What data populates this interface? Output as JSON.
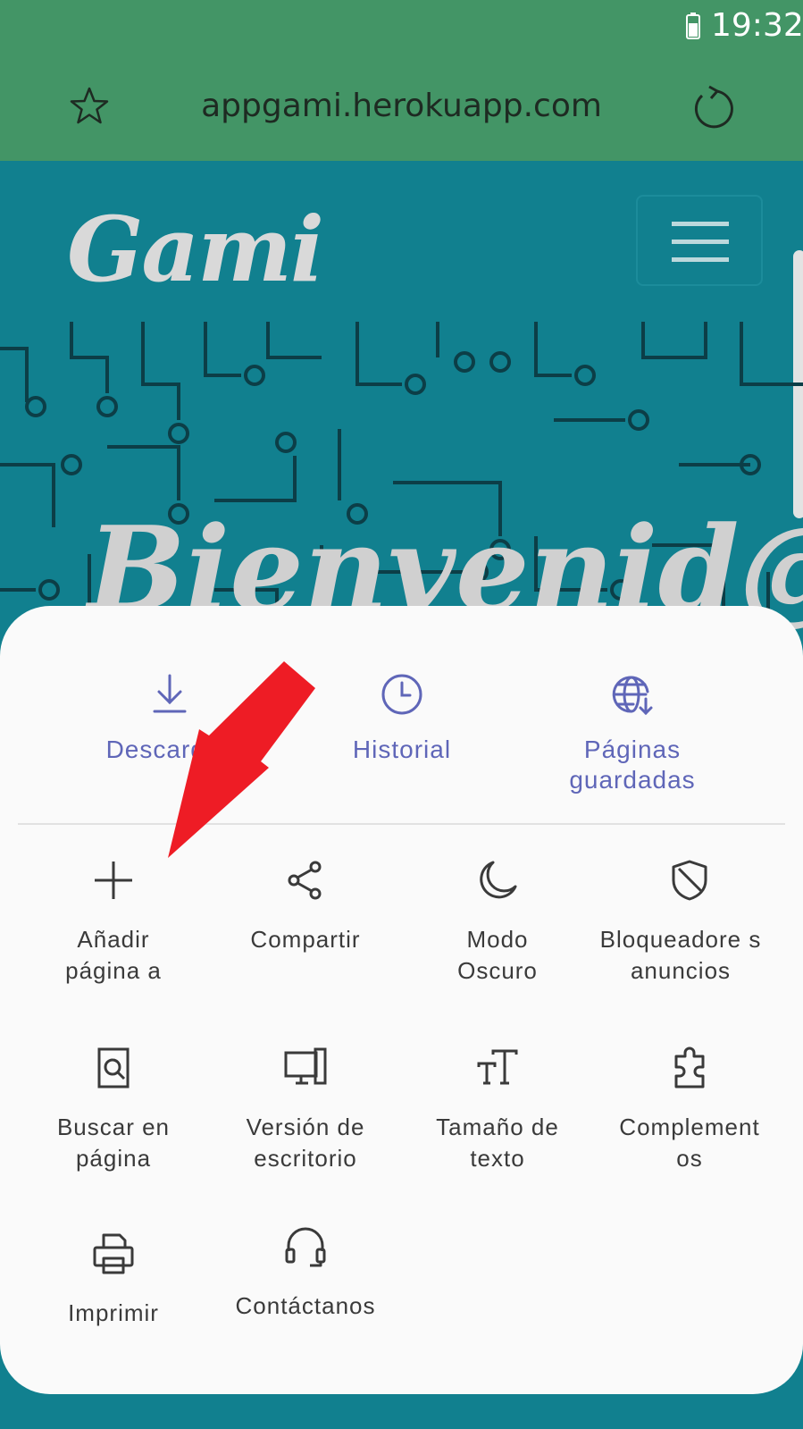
{
  "status_bar": {
    "time": "19:32"
  },
  "browser": {
    "url": "appgami.herokuapp.com"
  },
  "page": {
    "logo": "Gami",
    "welcome": "Bienvenid@s"
  },
  "quick_actions": [
    {
      "label": "Descargas",
      "icon": "download-icon"
    },
    {
      "label": "Historial",
      "icon": "clock-icon"
    },
    {
      "label": "Páginas guardadas",
      "icon": "globe-download-icon"
    }
  ],
  "menu_items": [
    {
      "label": "Añadir página a",
      "icon": "plus-icon"
    },
    {
      "label": "Compartir",
      "icon": "share-icon"
    },
    {
      "label": "Modo Oscuro",
      "icon": "moon-icon"
    },
    {
      "label": "Bloqueadore s anuncios",
      "icon": "shield-icon"
    },
    {
      "label": "Buscar en página",
      "icon": "find-in-page-icon"
    },
    {
      "label": "Versión de escritorio",
      "icon": "desktop-icon"
    },
    {
      "label": "Tamaño de texto",
      "icon": "text-size-icon"
    },
    {
      "label": "Complement os",
      "icon": "puzzle-icon"
    },
    {
      "label": "Imprimir",
      "icon": "printer-icon"
    },
    {
      "label": "Contáctanos",
      "icon": "headset-icon"
    }
  ],
  "colors": {
    "status_bar": "#439566",
    "page_bg": "#11808f",
    "accent": "#5f66b8",
    "annotation_arrow": "#ee1c25"
  }
}
